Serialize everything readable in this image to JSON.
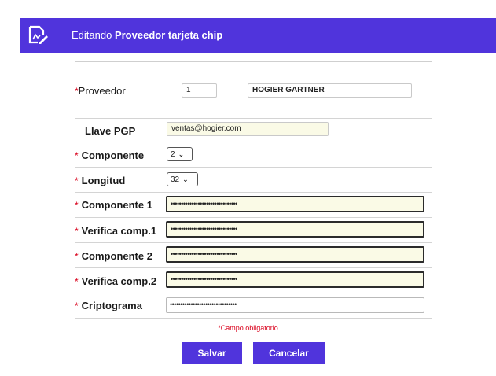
{
  "header": {
    "prefix": "Editando",
    "title": "Proveedor tarjeta chip",
    "icon": "edit-document-icon",
    "color": "#5034dc"
  },
  "form": {
    "required_mark": "*",
    "proveedor": {
      "label": "Proveedor",
      "code": "1",
      "name": "HOGIER GARTNER"
    },
    "llave_pgp": {
      "label": "Llave PGP",
      "value": "ventas@hogier.com"
    },
    "componente": {
      "label": "Componente",
      "value": "2"
    },
    "longitud": {
      "label": "Longitud",
      "value": "32"
    },
    "componente1": {
      "label": "Componente 1",
      "value": "••••••••••••••••••••••••••••••••"
    },
    "verifica1": {
      "label": "Verifica comp.1",
      "value": "••••••••••••••••••••••••••••••••"
    },
    "componente2": {
      "label": "Componente 2",
      "value": "••••••••••••••••••••••••••••••••"
    },
    "verifica2": {
      "label": "Verifica comp.2",
      "value": "••••••••••••••••••••••••••••••••"
    },
    "criptograma": {
      "label": "Criptograma",
      "value": "••••••••••••••••••••••••••••••••"
    }
  },
  "required_note": "Campo obligatorio",
  "buttons": {
    "save": "Salvar",
    "cancel": "Cancelar"
  }
}
